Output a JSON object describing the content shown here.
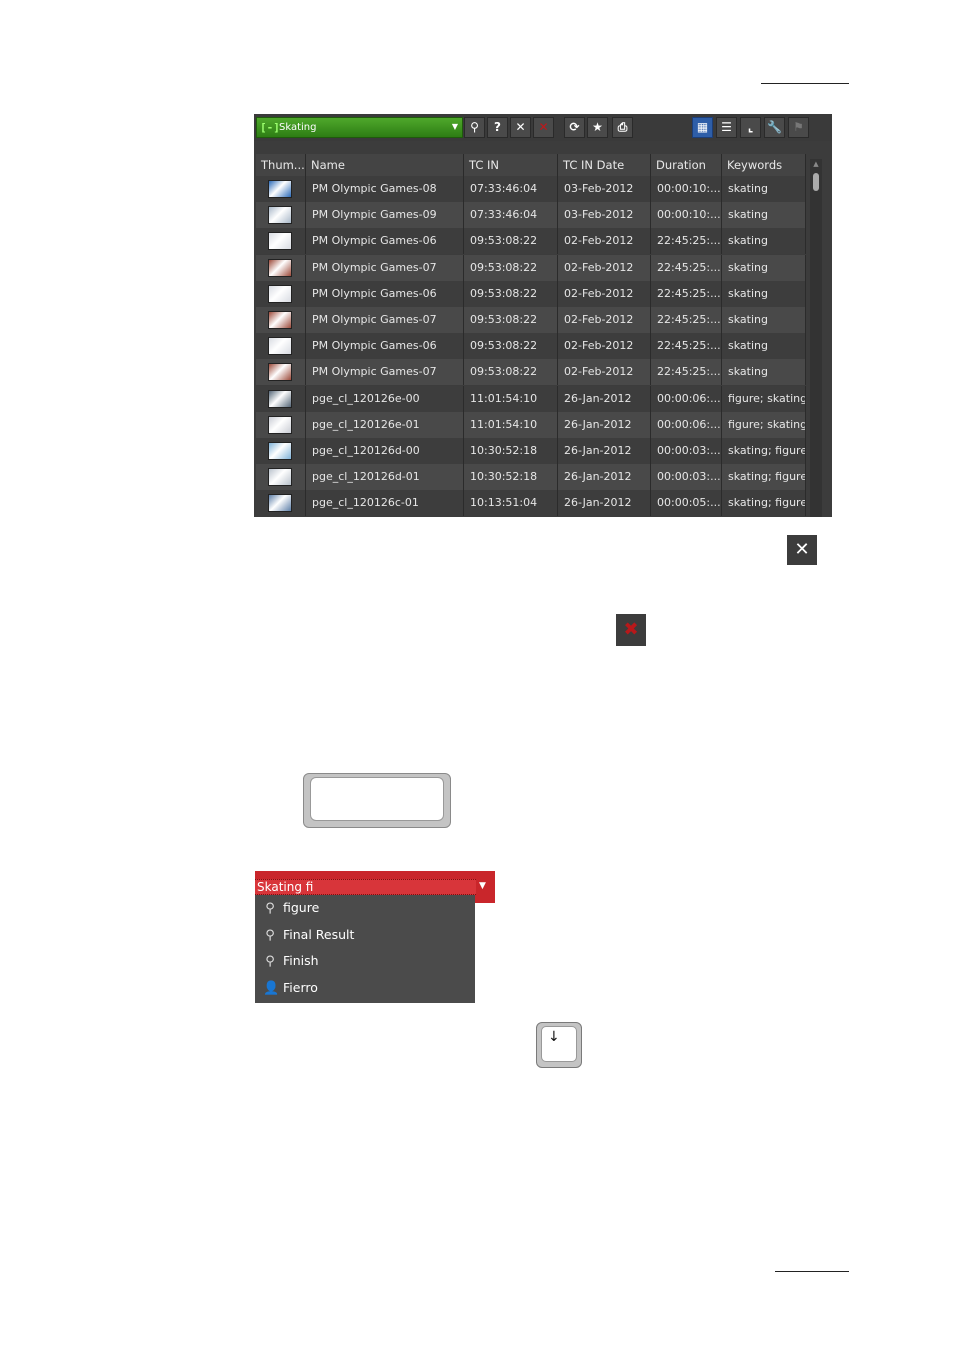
{
  "toolbar": {
    "search_value": "Skating",
    "bin_icon": "[-]",
    "buttons": [
      {
        "name": "search-icon",
        "glyph": "⚲"
      },
      {
        "name": "help-icon",
        "glyph": "?"
      },
      {
        "name": "clear-icon",
        "glyph": "✕"
      },
      {
        "name": "delete-red-icon",
        "glyph": "✕"
      },
      {
        "name": "refresh-icon",
        "glyph": "⟳"
      },
      {
        "name": "star-icon",
        "glyph": "★"
      },
      {
        "name": "print-icon",
        "glyph": "⎙"
      },
      {
        "name": "grid-view-icon",
        "glyph": "▦"
      },
      {
        "name": "list-view-icon",
        "glyph": "☰"
      },
      {
        "name": "chart-icon",
        "glyph": "⌞"
      },
      {
        "name": "wrench-icon",
        "glyph": "🔧"
      },
      {
        "name": "disabled-tool-icon",
        "glyph": "⚑"
      }
    ]
  },
  "table": {
    "headers": [
      "Thum...",
      "Name",
      "TC IN",
      "TC IN Date",
      "Duration",
      "Keywords"
    ],
    "rows": [
      {
        "thumb": "#2b6ab8",
        "name": "PM Olympic Games-08",
        "tcin": "07:33:46:04",
        "date": "03-Feb-2012",
        "dur": "00:00:10:...",
        "kw": "skating"
      },
      {
        "thumb": "#a8b7c8",
        "name": "PM Olympic Games-09",
        "tcin": "07:33:46:04",
        "date": "03-Feb-2012",
        "dur": "00:00:10:...",
        "kw": "skating"
      },
      {
        "thumb": "#d8dbe2",
        "name": "PM Olympic Games-06",
        "tcin": "09:53:08:22",
        "date": "02-Feb-2012",
        "dur": "22:45:25:...",
        "kw": "skating"
      },
      {
        "thumb": "#9c4a3a",
        "name": "PM Olympic Games-07",
        "tcin": "09:53:08:22",
        "date": "02-Feb-2012",
        "dur": "22:45:25:...",
        "kw": "skating"
      },
      {
        "thumb": "#d8dbe2",
        "name": "PM Olympic Games-06",
        "tcin": "09:53:08:22",
        "date": "02-Feb-2012",
        "dur": "22:45:25:...",
        "kw": "skating"
      },
      {
        "thumb": "#9c4a3a",
        "name": "PM Olympic Games-07",
        "tcin": "09:53:08:22",
        "date": "02-Feb-2012",
        "dur": "22:45:25:...",
        "kw": "skating"
      },
      {
        "thumb": "#d8dbe2",
        "name": "PM Olympic Games-06",
        "tcin": "09:53:08:22",
        "date": "02-Feb-2012",
        "dur": "22:45:25:...",
        "kw": "skating"
      },
      {
        "thumb": "#9c4a3a",
        "name": "PM Olympic Games-07",
        "tcin": "09:53:08:22",
        "date": "02-Feb-2012",
        "dur": "22:45:25:...",
        "kw": "skating"
      },
      {
        "thumb": "#556677",
        "name": "pge_cl_120126e-00",
        "tcin": "11:01:54:10",
        "date": "26-Jan-2012",
        "dur": "00:00:06:...",
        "kw": "figure; skating;"
      },
      {
        "thumb": "#c9ccd4",
        "name": "pge_cl_120126e-01",
        "tcin": "11:01:54:10",
        "date": "26-Jan-2012",
        "dur": "00:00:06:...",
        "kw": "figure; skating;"
      },
      {
        "thumb": "#7fb2d8",
        "name": "pge_cl_120126d-00",
        "tcin": "10:30:52:18",
        "date": "26-Jan-2012",
        "dur": "00:00:03:...",
        "kw": "skating; figure"
      },
      {
        "thumb": "#b9c2cc",
        "name": "pge_cl_120126d-01",
        "tcin": "10:30:52:18",
        "date": "26-Jan-2012",
        "dur": "00:00:03:...",
        "kw": "skating; figure"
      },
      {
        "thumb": "#5d7fa8",
        "name": "pge_cl_120126c-01",
        "tcin": "10:13:51:04",
        "date": "26-Jan-2012",
        "dur": "00:00:05:...",
        "kw": "skating; figure"
      }
    ]
  },
  "icons": {
    "close_glyph": "✕",
    "red_x_glyph": "✖",
    "key_small_glyph": "↓"
  },
  "autocomplete": {
    "value": "Skating fi",
    "items": [
      {
        "label": "figure",
        "icon": "keyword-icon",
        "glyph": "⚲"
      },
      {
        "label": "Final Result",
        "icon": "keyword-icon",
        "glyph": "⚲"
      },
      {
        "label": "Finish",
        "icon": "keyword-icon",
        "glyph": "⚲"
      },
      {
        "label": "Fierro",
        "icon": "person-icon",
        "glyph": "👤"
      }
    ]
  },
  "colors": {
    "panel_bg": "#3c3c3c",
    "search_green": "#3f961f",
    "autocomplete_red": "#c9262b",
    "active_button_blue": "#2e5ea8"
  }
}
